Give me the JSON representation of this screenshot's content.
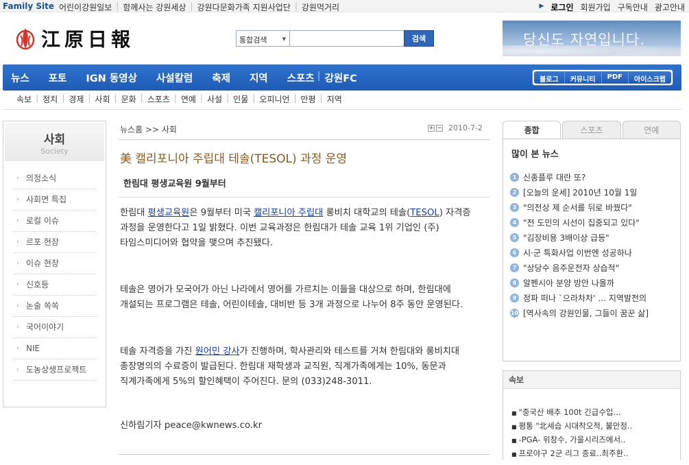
{
  "family": {
    "label": "Family Site",
    "links": [
      "어린이강원일보",
      "함께사는 강원세상",
      "강원다문화가족 지원사업단",
      "강원먹거리"
    ]
  },
  "util": [
    "로그인",
    "회원가입",
    "구독안내",
    "광고안내"
  ],
  "logo": {
    "name": "江原日報"
  },
  "search": {
    "select_value": "통합검색",
    "button": "검색",
    "placeholder": ""
  },
  "banner": {
    "text": "당신도 자연입니다."
  },
  "gnb": {
    "items": [
      "뉴스",
      "포토",
      "IGN 동영상",
      "사설칼럼",
      "축제",
      "지역",
      "스포츠",
      "강원FC"
    ],
    "sub": [
      "블로그",
      "커뮤니티",
      "PDF",
      "아이스크랩"
    ]
  },
  "lnb": [
    "속보",
    "정치",
    "경제",
    "사회",
    "문화",
    "스포츠",
    "연예",
    "사설",
    "인물",
    "오피니언",
    "만평",
    "지역"
  ],
  "section": {
    "title": "사회",
    "title_en": "Society",
    "items": [
      "의정소식",
      "사회면 특집",
      "로컬 이슈",
      "르포 현장",
      "이슈 현장",
      "신호등",
      "논술 쏙쏙",
      "국어이야기",
      "NIE",
      "도농상생프로젝트"
    ]
  },
  "article": {
    "breadcrumb": "뉴스홈 >> 사회",
    "date": "2010-7-2",
    "title": "美 캘리포니아 주립대 테솔(TESOL) 과정 운영",
    "subtitle": "한림대 평생교육원 9월부터",
    "p1": {
      "a": "한림대 ",
      "l1": "평생교육원",
      "b": "은 9월부터 미국 ",
      "l2": "캘리포니아 주립대",
      "c": " 롱비치 대학교의 테솔(",
      "l3": "TESOL",
      "d": ") 자격증 과정을 운영한다고 1일 밝혔다. 이번 교육과정은 한림대가 테솔 교육 1위 기업인 (주)타임스미디어와 협약을 맺으며 추진됐다."
    },
    "p2": "테솔은 영어가 모국어가 아닌 나라에서 영어를 가르치는 이들을 대상으로 하며, 한림대에 개설되는 프로그램은 테솔, 어린이테솔, 대비반 등 3개 과정으로 나누어 8주 동안 운영된다.",
    "p3": {
      "a": "테솔 자격증을 가진 ",
      "l1": "원어민 강사",
      "b": "가 진행하며, 학사관리와 테스트를 거쳐 한림대와 롱비치대 총장명의의 수료증이 발급된다. 한림대 재학생과 교직원, 직계가족에게는 10%, 동문과 직계가족에게 5%의 할인혜택이 주어진다. 문의 (033)248-3011."
    },
    "byline": "신하림기자 peace@kwnews.co.kr"
  },
  "rank": {
    "tabs": [
      "종합",
      "스포츠",
      "연예"
    ],
    "heading": "많이 본 뉴스",
    "items": [
      "신종플루 대란 또?",
      "[오늘의 운세] 2010년 10월 1일",
      "\"의전상 제 순서를 뒤로 바꿨다\"",
      "\"전 도민의 시선이 집중되고 있다\"",
      "\"김장비용 3배이상 급등\"",
      "시·군 특화사업 이번엔 성공하나",
      "\"상당수 음주운전자 상습적\"",
      "알펜시아 분양 방안 나올까",
      "정파 떠나 `으라차차' … 지역발전의",
      "[역사속의 강원인물, 그들이 꿈꾼 삶]"
    ]
  },
  "breaking": {
    "heading": "속보",
    "items": [
      "\"중국산 배추 100t 긴급수입...",
      "평통 \"北세습 시대착오적, 불안정..",
      "-PGA- 위창수, 가을시리즈에서..",
      "프로야구 2군 리그 종료..최주환.."
    ]
  },
  "colors": {
    "brand": "#1e5bb5",
    "title": "#8a5a1e",
    "link": "#1a3fa8"
  }
}
